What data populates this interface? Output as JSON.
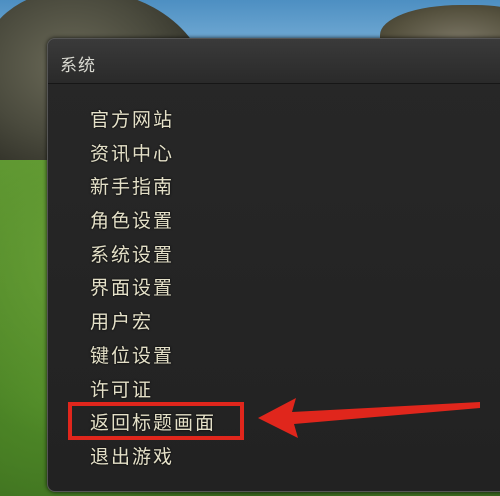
{
  "window": {
    "title": "系统"
  },
  "menu": {
    "items": [
      {
        "label": "官方网站"
      },
      {
        "label": "资讯中心"
      },
      {
        "label": "新手指南"
      },
      {
        "label": "角色设置"
      },
      {
        "label": "系统设置"
      },
      {
        "label": "界面设置"
      },
      {
        "label": "用户宏"
      },
      {
        "label": "键位设置"
      },
      {
        "label": "许可证"
      },
      {
        "label": "返回标题画面"
      },
      {
        "label": "退出游戏"
      }
    ]
  },
  "annotation": {
    "highlight_color": "#e0261c",
    "arrow_color": "#e0261c",
    "highlighted_item": "返回标题画面"
  },
  "colors": {
    "menu_text": "#e4e0c8",
    "title_text": "#d8d8d0",
    "panel_bg": "#222222"
  }
}
